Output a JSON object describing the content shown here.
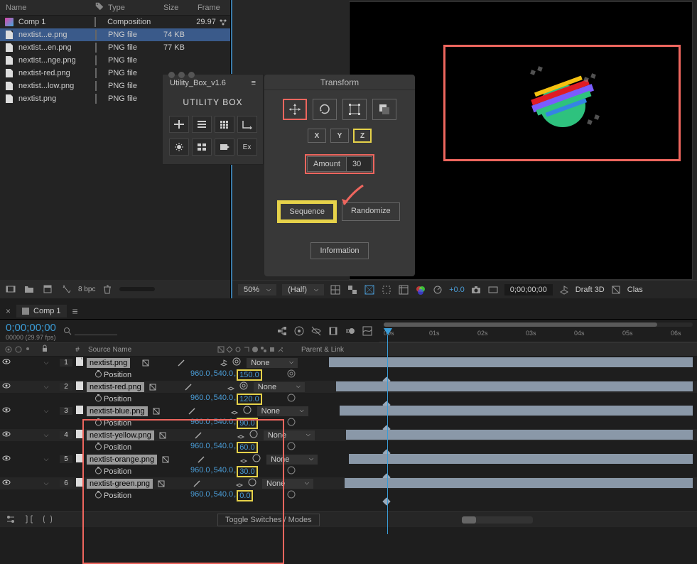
{
  "project": {
    "columns": {
      "name": "Name",
      "type": "Type",
      "size": "Size",
      "frame": "Frame"
    },
    "items": [
      {
        "name": "Comp 1",
        "type": "Composition",
        "size": "",
        "frame": "29.97",
        "kind": "comp"
      },
      {
        "name": "nextist...e.png",
        "type": "PNG file",
        "size": "74 KB",
        "kind": "png",
        "selected": true
      },
      {
        "name": "nextist...en.png",
        "type": "PNG file",
        "size": "77 KB",
        "kind": "png"
      },
      {
        "name": "nextist...nge.png",
        "type": "PNG file",
        "size": "",
        "kind": "png"
      },
      {
        "name": "nextist-red.png",
        "type": "PNG file",
        "size": "",
        "kind": "png"
      },
      {
        "name": "nextist...low.png",
        "type": "PNG file",
        "size": "",
        "kind": "png"
      },
      {
        "name": "nextist.png",
        "type": "PNG file",
        "size": "",
        "kind": "png"
      }
    ],
    "footer": {
      "bpc": "8 bpc"
    }
  },
  "utilitybox": {
    "title": "Utility_Box_v1.6",
    "logo": "UTILITY BOX",
    "grid2": [
      "Ex"
    ]
  },
  "transform": {
    "title": "Transform",
    "xyz": [
      "X",
      "Y",
      "Z"
    ],
    "amount_label": "Amount",
    "amount_value": "30",
    "sequence": "Sequence",
    "randomize": "Randomize",
    "information": "Information"
  },
  "viewer": {
    "zoom": "50%",
    "quality": "(Half)",
    "exposure": "+0.0",
    "timecode": "0;00;00;00",
    "draft3d": "Draft 3D",
    "clas": "Clas"
  },
  "timeline": {
    "comp_name": "Comp 1",
    "timecode": "0;00;00;00",
    "fps_text": "00000 (29.97 fps)",
    "search_ph": "",
    "cols": {
      "num": "#",
      "source": "Source Name",
      "parent": "Parent & Link"
    },
    "ruler": [
      "00s",
      "01s",
      "02s",
      "03s",
      "04s",
      "05s",
      "06s"
    ],
    "layers": [
      {
        "n": "1",
        "name": "nextist.png",
        "none": "None",
        "prop": "Position",
        "px": "960.0",
        "py": "540.0",
        "pz": "150.0"
      },
      {
        "n": "2",
        "name": "nextist-red.png",
        "none": "None",
        "prop": "Position",
        "px": "960.0",
        "py": "540.0",
        "pz": "120.0"
      },
      {
        "n": "3",
        "name": "nextist-blue.png",
        "none": "None",
        "prop": "Position",
        "px": "960.0",
        "py": "540.0",
        "pz": "90.0"
      },
      {
        "n": "4",
        "name": "nextist-yellow.png",
        "none": "None",
        "prop": "Position",
        "px": "960.0",
        "py": "540.0",
        "pz": "60.0"
      },
      {
        "n": "5",
        "name": "nextist-orange.png",
        "none": "None",
        "prop": "Position",
        "px": "960.0",
        "py": "540.0",
        "pz": "30.0"
      },
      {
        "n": "6",
        "name": "nextist-green.png",
        "none": "None",
        "prop": "Position",
        "px": "960.0",
        "py": "540.0",
        "pz": "0.0"
      }
    ],
    "toggle": "Toggle Switches / Modes"
  },
  "colors": {
    "accent": "#3a9cd6",
    "hl_red": "#ee665e",
    "hl_yellow": "#e6d24a"
  }
}
